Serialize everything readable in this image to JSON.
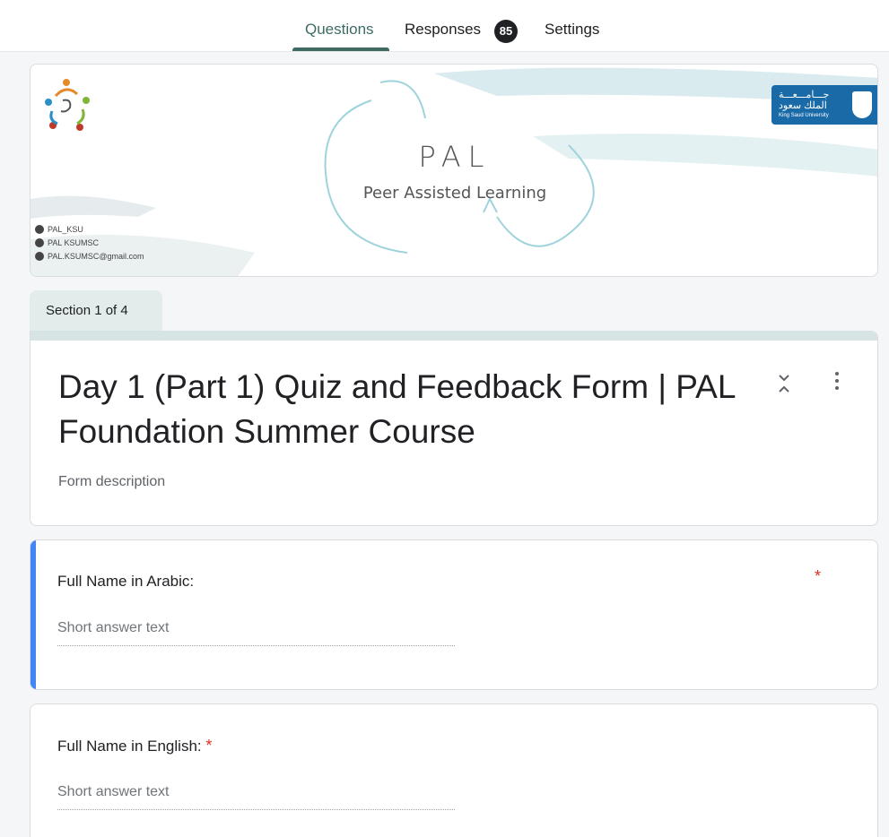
{
  "tabs": {
    "questions": "Questions",
    "responses": "Responses",
    "responses_count": "85",
    "settings": "Settings"
  },
  "banner": {
    "title": "PAL",
    "subtitle": "Peer Assisted Learning",
    "contacts": [
      "PAL_KSU",
      "PAL KSUMSC",
      "PAL.KSUMSC@gmail.com"
    ],
    "university": {
      "arabic_line1": "جـــامـــعـــة",
      "arabic_line2": "الملك سعود",
      "english": "King Saud University",
      "color": "#1a6aa8"
    }
  },
  "section": {
    "label": "Section 1 of 4"
  },
  "form": {
    "title": "Day 1 (Part 1) Quiz and Feedback Form | PAL Foundation Summer Course",
    "description": "Form description"
  },
  "questions": [
    {
      "title": "Full Name in Arabic:",
      "required_mark": "*",
      "placeholder": "Short answer text"
    },
    {
      "title": "Full Name in English:",
      "required_mark": "*",
      "placeholder": "Short answer text"
    }
  ],
  "colors": {
    "theme": "#3d6b63",
    "active_bar": "#4285f4",
    "required": "#d93025"
  },
  "icons": {
    "collapse": "collapse-icon",
    "more": "more-vert-icon"
  }
}
